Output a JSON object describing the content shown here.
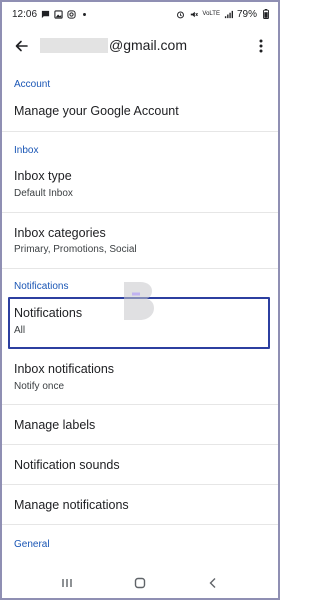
{
  "status_bar": {
    "time": "12:06",
    "network_label": "VoLTE",
    "battery": "79%"
  },
  "app_bar": {
    "email_suffix": "@gmail.com"
  },
  "sections": {
    "account": {
      "header": "Account",
      "manage_account": "Manage your Google Account"
    },
    "inbox": {
      "header": "Inbox",
      "inbox_type_title": "Inbox type",
      "inbox_type_value": "Default Inbox",
      "inbox_categories_title": "Inbox categories",
      "inbox_categories_value": "Primary, Promotions, Social"
    },
    "notifications": {
      "header": "Notifications",
      "notifications_title": "Notifications",
      "notifications_value": "All",
      "inbox_notifications_title": "Inbox notifications",
      "inbox_notifications_value": "Notify once",
      "manage_labels": "Manage labels",
      "notification_sounds": "Notification sounds",
      "manage_notifications": "Manage notifications"
    },
    "general": {
      "header": "General"
    }
  },
  "icons": {
    "back": "arrow-back-icon",
    "more": "more-vert-icon",
    "nav_recents": "recents-icon",
    "nav_home": "home-icon",
    "nav_back": "nav-back-icon"
  },
  "colors": {
    "section_header": "#1a56b5",
    "highlight_border": "#2c3fa0"
  }
}
